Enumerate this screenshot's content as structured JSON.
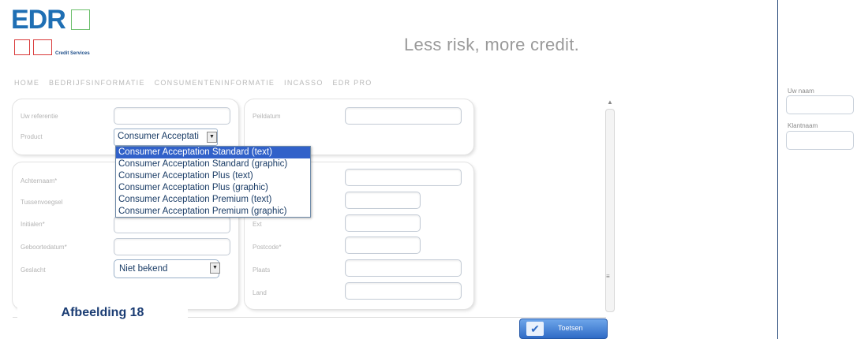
{
  "logo": {
    "brand": "EDR",
    "sub": "Credit Services"
  },
  "tagline": "Less risk, more credit.",
  "nav": [
    "HOME",
    "BEDRIJFSINFORMATIE",
    "CONSUMENTENINFORMATIE",
    "INCASSO",
    "EDR PRO"
  ],
  "sidebar": {
    "name_label": "Uw naam",
    "client_label": "Klantnaam"
  },
  "form_top": {
    "reference_label": "Uw referentie",
    "product_label": "Product",
    "product_value": "Consumer Acceptati",
    "postdate_label": "Peildatum"
  },
  "dropdown": {
    "options": [
      "Consumer Acceptation Standard (text)",
      "Consumer Acceptation Standard (graphic)",
      "Consumer Acceptation Plus (text)",
      "Consumer Acceptation Plus (graphic)",
      "Consumer Acceptation Premium (text)",
      "Consumer Acceptation Premium (graphic)"
    ],
    "selected_index": 0
  },
  "form_bottom": {
    "surname_label": "Achternaam*",
    "prefix_label": "Tussenvoegsel",
    "initials_label": "Initialen*",
    "dob_label": "Geboortedatum*",
    "gender_label": "Geslacht",
    "gender_value": "Niet bekend",
    "ext_label": "Ext",
    "postcode_label": "Postcode*",
    "city_label": "Plaats",
    "country_label": "Land"
  },
  "badge": "Afbeelding 18",
  "button": {
    "label": "Toetsen",
    "icon": "check-icon"
  },
  "colors": {
    "brand_blue": "#1f6fb4",
    "select_blue": "#3161c9",
    "logo_green": "#6cbf6c",
    "logo_red": "#d93a3a"
  }
}
